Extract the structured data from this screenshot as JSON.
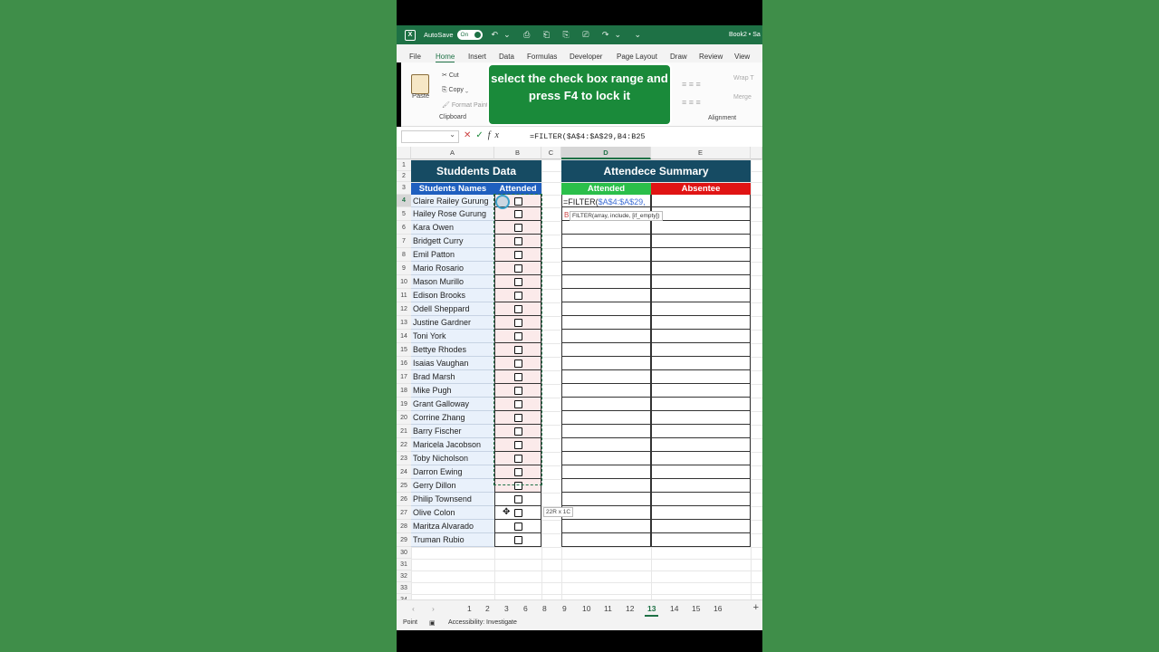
{
  "titlebar": {
    "autosave": "AutoSave",
    "toggle": "On",
    "doc": "Book2 • Sa"
  },
  "tabs": [
    "File",
    "Home",
    "Insert",
    "Data",
    "Formulas",
    "Developer",
    "Page Layout",
    "Draw",
    "Review",
    "View"
  ],
  "ribbon": {
    "paste": "Paste",
    "cut": "Cut",
    "copy": "Copy",
    "format_painter": "Format Paint",
    "clipboard": "Clipboard",
    "wrap": "Wrap T",
    "merge": "Merge",
    "alignment": "Alignment"
  },
  "overlay": {
    "text": "select the check box range and press F4 to lock it"
  },
  "formula_bar": {
    "name_box": "",
    "formula": "=FILTER($A$4:$A$29,B4:B25"
  },
  "columns": [
    "A",
    "B",
    "C",
    "D",
    "E"
  ],
  "students": {
    "title": "Studdents Data",
    "col_names": "Students Names",
    "col_attended": "Attended",
    "names": [
      "Claire Railey Gurung",
      "Hailey Rose Gurung",
      "Kara Owen",
      "Bridgett Curry",
      "Emil Patton",
      "Mario Rosario",
      "Mason Murillo",
      "Edison Brooks",
      "Odell Sheppard",
      "Justine Gardner",
      "Toni York",
      "Bettye Rhodes",
      "Isaias Vaughan",
      "Brad Marsh",
      "Mike Pugh",
      "Grant Galloway",
      "Corrine Zhang",
      "Barry Fischer",
      "Maricela Jacobson",
      "Toby Nicholson",
      "Darron Ewing",
      "Gerry Dillon",
      "Philip Townsend",
      "Olive Colon",
      "Maritza Alvarado",
      "Truman Rubio"
    ]
  },
  "summary": {
    "title": "Attendece Summary",
    "attended": "Attended",
    "absentee": "Absentee",
    "attended_color": "#2bbf4a",
    "absentee_color": "#e01414"
  },
  "edit": {
    "prefix": "=FILTER(",
    "ref": "$A$4:$A$29,",
    "next_line": "B",
    "hint": "FILTER(array, include, [if_empty])",
    "size_badge": "22R x 1C"
  },
  "sheet_tabs": [
    "1",
    "2",
    "3",
    "6",
    "8",
    "9",
    "10",
    "11",
    "12",
    "13",
    "14",
    "15",
    "16"
  ],
  "active_sheet": "13",
  "status": {
    "mode": "Point",
    "accessibility": "Accessibility: Investigate"
  },
  "colors": {
    "banner": "#164b63",
    "subheader_blue": "#1f5fbf",
    "excel_green": "#1e7145"
  }
}
